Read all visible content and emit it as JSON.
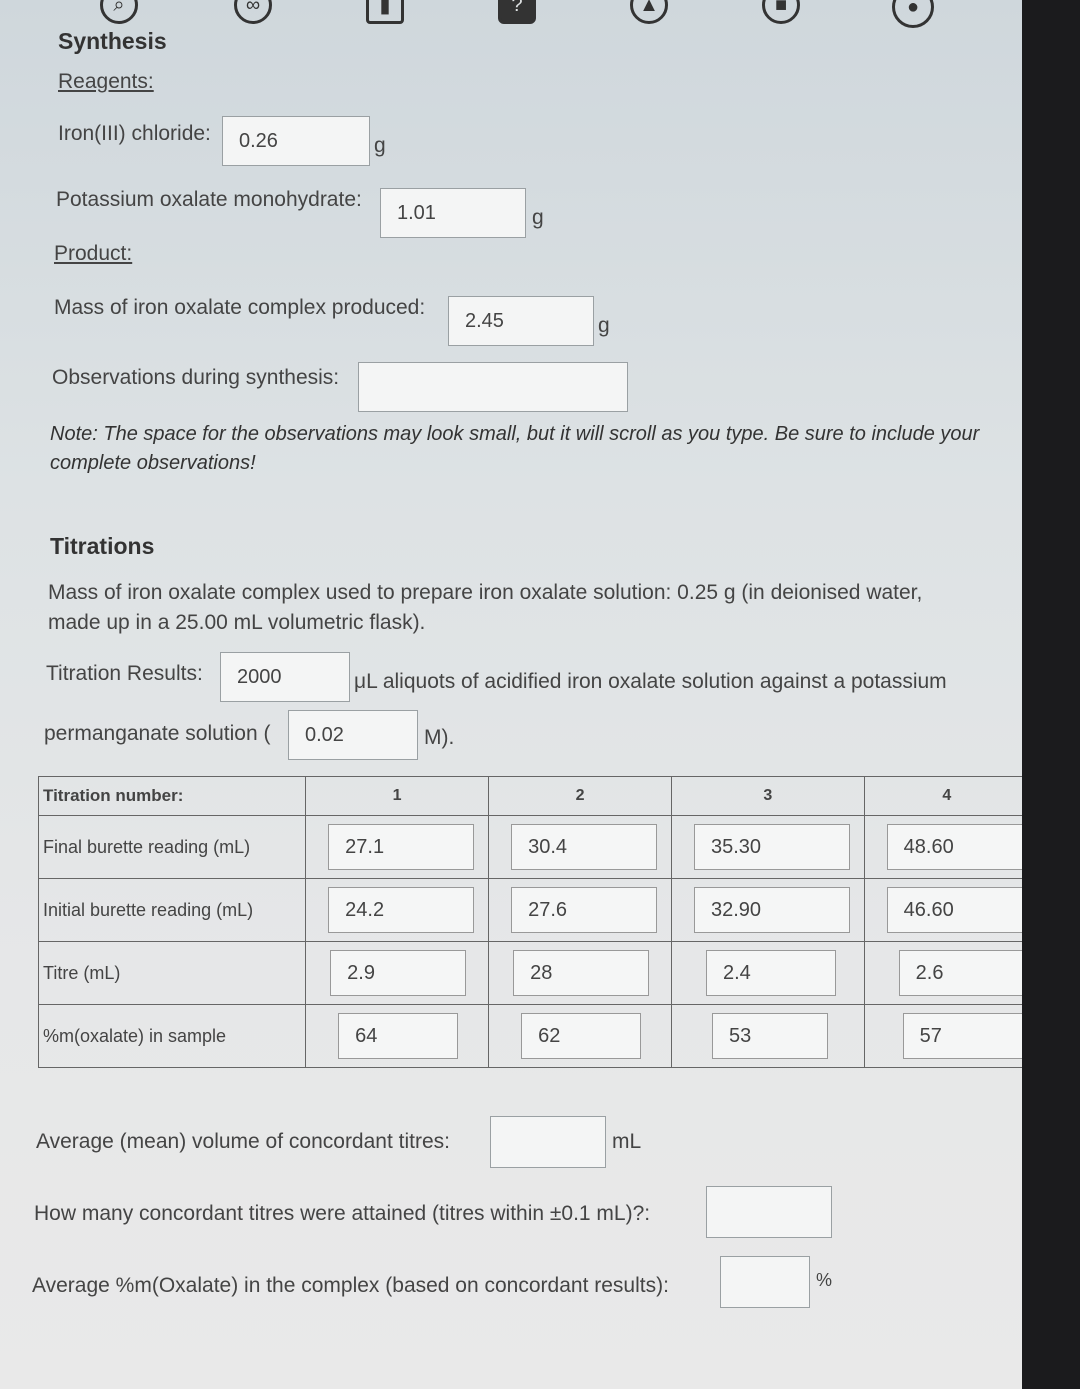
{
  "toolbar": {
    "icons": [
      "search-icon",
      "link-icon",
      "book-icon",
      "help-icon",
      "notification-icon",
      "chat-icon",
      "user-icon"
    ],
    "help_glyph": "?"
  },
  "synthesis": {
    "title": "Synthesis",
    "reagents_label": "Reagents:",
    "iron_label": "Iron(III) chloride:",
    "iron_value": "0.26",
    "iron_unit": "g",
    "oxalate_label": "Potassium oxalate monohydrate:",
    "oxalate_value": "1.01",
    "oxalate_unit": "g",
    "product_label": "Product:",
    "mass_label": "Mass of iron oxalate complex produced:",
    "mass_value": "2.45",
    "mass_unit": "g",
    "obs_label": "Observations during synthesis:",
    "obs_value": "",
    "note": "Note: The space for the observations may look small, but it will scroll as you type. Be sure to include your complete observations!"
  },
  "titrations": {
    "title": "Titrations",
    "mass_text": "Mass of iron oxalate complex used to prepare iron oxalate solution: 0.25 g (in deionised water, made up in a 25.00 mL volumetric flask).",
    "results_label": "Titration Results:",
    "aliquot_value": "2000",
    "aliquot_text": "μL aliquots of acidified iron oxalate solution against a potassium",
    "permanganate_label": "permanganate solution (",
    "permanganate_value": "0.02",
    "permanganate_unit": "M).",
    "table": {
      "header_label": "Titration number:",
      "columns": [
        "1",
        "2",
        "3",
        "4"
      ],
      "rows": [
        {
          "label": "Final burette reading (mL)",
          "values": [
            "27.1",
            "30.4",
            "35.30",
            "48.60"
          ]
        },
        {
          "label": "Initial burette reading (mL)",
          "values": [
            "24.2",
            "27.6",
            "32.90",
            "46.60"
          ]
        },
        {
          "label": "Titre (mL)",
          "values": [
            "2.9",
            "28",
            "2.4",
            "2.6"
          ]
        },
        {
          "label": "%m(oxalate) in sample",
          "values": [
            "64",
            "62",
            "53",
            "57"
          ]
        }
      ]
    },
    "avg_label": "Average (mean) volume of concordant titres:",
    "avg_value": "",
    "avg_unit": "mL",
    "count_label": "How many concordant titres were attained (titres within ±0.1 mL)?:",
    "count_value": "",
    "avgpct_label": "Average %m(Oxalate) in the complex (based on concordant results):",
    "avgpct_value": "",
    "avgpct_unit": "%"
  }
}
